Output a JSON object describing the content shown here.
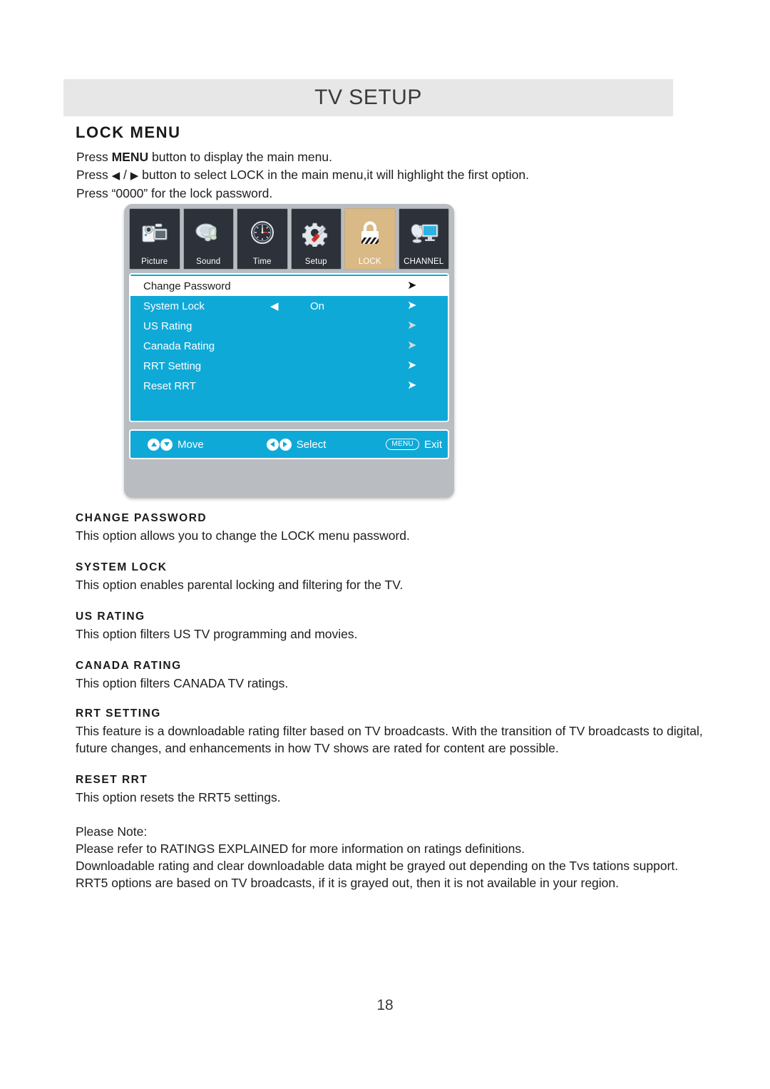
{
  "header": {
    "title": "TV SETUP"
  },
  "section": {
    "heading": "LOCK MENU",
    "intro_line1_pre": "Press ",
    "intro_line1_bold": "MENU",
    "intro_line1_post": " button to display the main menu.",
    "intro_line2_pre": "Press ",
    "intro_line2_left_arrow": "◀",
    "intro_line2_mid": " / ",
    "intro_line2_right_arrow": "▶",
    "intro_line2_post": " button to select LOCK in the main menu,it will highlight the first option.",
    "intro_line3": "Press “0000” for the lock password."
  },
  "osd": {
    "tabs": [
      {
        "label": "Picture",
        "icon": "camcorder-icon",
        "active": false
      },
      {
        "label": "Sound",
        "icon": "speaker-music-note-icon",
        "active": false
      },
      {
        "label": "Time",
        "icon": "clock-icon",
        "active": false
      },
      {
        "label": "Setup",
        "icon": "gear-screwdriver-icon",
        "active": false
      },
      {
        "label": "LOCK",
        "icon": "padlock-icon",
        "active": true
      },
      {
        "label": "CHANNEL",
        "icon": "satellite-dish-monitor-icon",
        "active": false
      }
    ],
    "rows": [
      {
        "label": "Change Password",
        "value": "",
        "left_arrow": "",
        "right_arrow": "➤",
        "highlighted": true
      },
      {
        "label": "System Lock",
        "value": "On",
        "left_arrow": "◀",
        "right_arrow": "➤",
        "highlighted": false
      },
      {
        "label": "US Rating",
        "value": "",
        "left_arrow": "",
        "right_arrow": "➤",
        "highlighted": false
      },
      {
        "label": "Canada Rating",
        "value": "",
        "left_arrow": "",
        "right_arrow": "➤",
        "highlighted": false
      },
      {
        "label": "RRT Setting",
        "value": "",
        "left_arrow": "",
        "right_arrow": "➤",
        "highlighted": false
      },
      {
        "label": "Reset RRT",
        "value": "",
        "left_arrow": "",
        "right_arrow": "➤",
        "highlighted": false
      }
    ],
    "footer": {
      "move_label": "Move",
      "select_label": "Select",
      "menu_button_label": "MENU",
      "exit_label": "Exit"
    },
    "colors": {
      "menu_blue": "#0fa9d8",
      "tab_dark": "#2d3139",
      "lock_highlight": "#d9b986",
      "frame_gray": "#b9bcc0"
    }
  },
  "descriptions": [
    {
      "title": "CHANGE PASSWORD",
      "body": "This option allows you to change the LOCK menu password."
    },
    {
      "title": "SYSTEM LOCK",
      "body": "This option enables parental locking and filtering for the TV."
    },
    {
      "title": "US RATING",
      "body": "This option filters US TV programming and movies."
    },
    {
      "title": "CANADA  RATING",
      "body": "This option filters CANADA TV ratings."
    },
    {
      "title": "RRT SETTING",
      "body": "This feature is a downloadable rating filter based on TV broadcasts. With the transition of TV broadcasts to digital, future changes, and enhancements in how TV shows are rated for content are possible."
    },
    {
      "title": "RESET RRT",
      "body": "This option resets the RRT5 settings."
    }
  ],
  "note": {
    "line1": "Please Note:",
    "line2": "Please refer to RATINGS EXPLAINED for more information on ratings definitions.",
    "line3": "Downloadable rating and clear downloadable data might be grayed out depending on the Tvs tations support.",
    "line4": "RRT5 options are based on TV broadcasts, if it is grayed out, then it is not available in your region."
  },
  "footer": {
    "page_number": "18"
  }
}
